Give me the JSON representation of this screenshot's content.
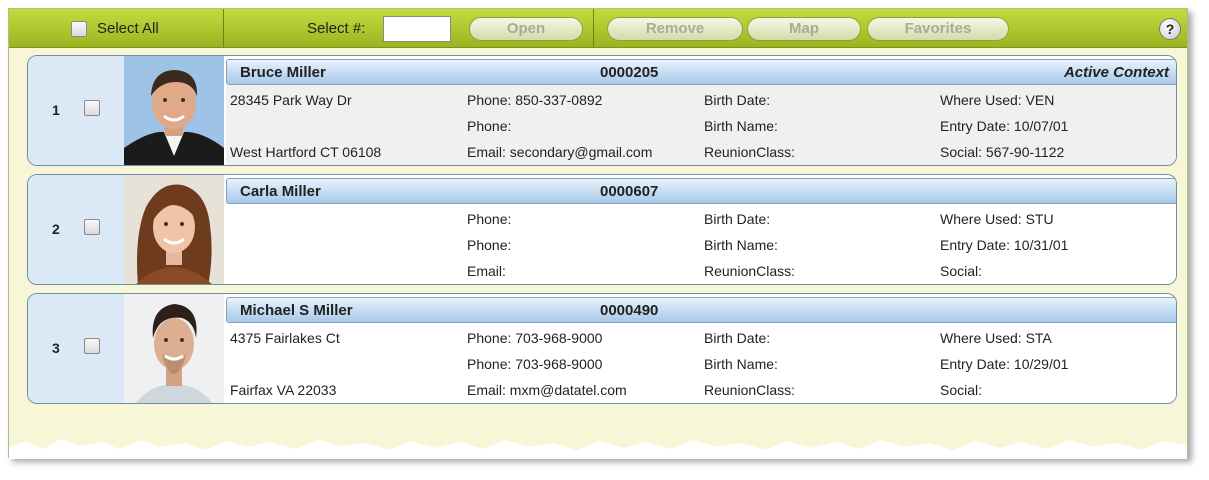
{
  "toolbar": {
    "select_all_label": "Select All",
    "select_num_label": "Select #:",
    "select_num_value": "",
    "buttons": {
      "open": "Open",
      "remove": "Remove",
      "map": "Map",
      "favorites": "Favorites"
    },
    "help_label": "?"
  },
  "records": [
    {
      "number": "1",
      "name": "Bruce Miller",
      "id": "0000205",
      "context": "Active Context",
      "address_line1": "28345 Park Way Dr",
      "address_line2": "",
      "city_state_zip": "West Hartford CT 06108",
      "phone1": "Phone: 850-337-0892",
      "phone2": "Phone:",
      "email": "Email: secondary@gmail.com",
      "birth_date": "Birth Date:",
      "birth_name": "Birth Name:",
      "reunion_class": "ReunionClass:",
      "where_used": "Where Used: VEN",
      "entry_date": "Entry Date: 10/07/01",
      "social": "Social: 567-90-1122"
    },
    {
      "number": "2",
      "name": "Carla Miller",
      "id": "0000607",
      "context": "",
      "address_line1": "",
      "address_line2": "",
      "city_state_zip": "",
      "phone1": "Phone:",
      "phone2": "Phone:",
      "email": "Email:",
      "birth_date": "Birth Date:",
      "birth_name": "Birth Name:",
      "reunion_class": "ReunionClass:",
      "where_used": "Where Used: STU",
      "entry_date": "Entry Date: 10/31/01",
      "social": "Social:"
    },
    {
      "number": "3",
      "name": "Michael S Miller",
      "id": "0000490",
      "context": "",
      "address_line1": "4375 Fairlakes Ct",
      "address_line2": "",
      "city_state_zip": "Fairfax VA 22033",
      "phone1": "Phone: 703-968-9000",
      "phone2": "Phone: 703-968-9000",
      "email": "Email: mxm@datatel.com",
      "birth_date": "Birth Date:",
      "birth_name": "Birth Name:",
      "reunion_class": "ReunionClass:",
      "where_used": "Where Used: STA",
      "entry_date": "Entry Date: 10/29/01",
      "social": "Social:"
    }
  ]
}
